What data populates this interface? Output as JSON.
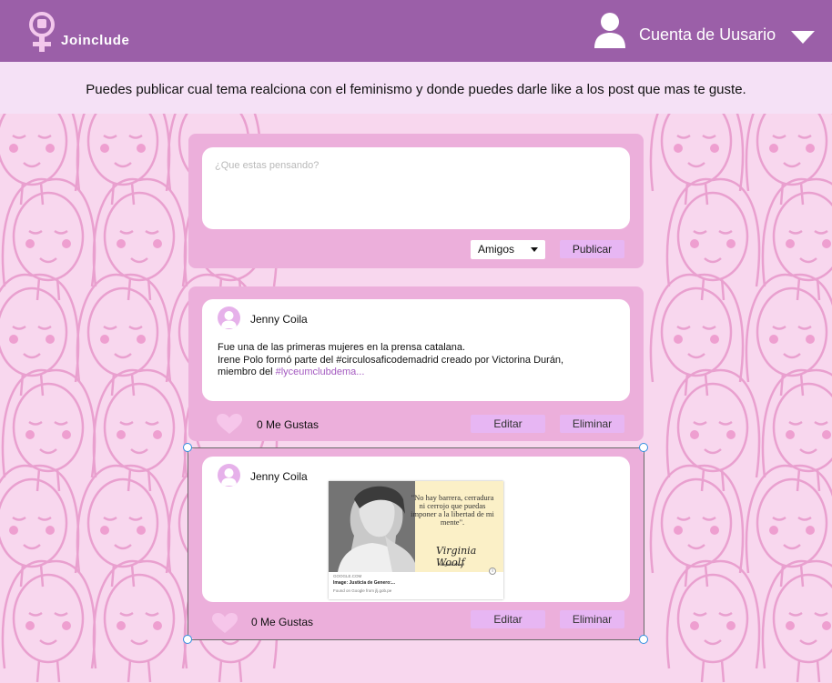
{
  "app": {
    "brand": "Joinclude",
    "account_label": "Cuenta de Uusario"
  },
  "info": {
    "text": "Puedes publicar cual tema  realciona con el feminismo y donde puedes darle like a los post que mas te guste."
  },
  "composer": {
    "placeholder": "¿Que estas pensando?",
    "audience_selected": "Amigos",
    "publish_label": "Publicar"
  },
  "posts": [
    {
      "author": "Jenny Coila",
      "text_line1": "Fue una de las primeras mujeres en la prensa catalana.",
      "text_line2": "Irene Polo formó parte del #circulosaficodemadrid creado por Victorina Durán,",
      "text_line3_prefix": "miembro del ",
      "hashtag": "#lyceumclubdema...",
      "likes_label": "0 Me Gustas",
      "edit_label": "Editar",
      "delete_label": "Eliminar"
    },
    {
      "author": "Jenny Coila",
      "likes_label": "0 Me Gustas",
      "edit_label": "Editar",
      "delete_label": "Eliminar",
      "preview": {
        "quote": "\"No hay barrera, cerradura ni cerrojo que puedas imponer a la libertad de mi mente\".",
        "signature": "Virginia Woolf",
        "signature_name": "Virginia Woolf",
        "source": "GOOGLE.COM",
        "title": "Image: Justicia de Genero:...",
        "found": "Found on Google from jlj.gob.pe"
      }
    }
  ],
  "colors": {
    "header": "#9b5fa8",
    "info_bar": "#f5e1f6",
    "card": "#ecafdb",
    "button": "#e7b6f3",
    "background": "#f8d7ee",
    "pattern_line": "#e9a0cf"
  },
  "icons": {
    "logo": "female-symbol-fist-icon",
    "user": "user-icon",
    "dropdown": "chevron-down-icon",
    "like": "heart-icon",
    "avatar": "avatar-icon"
  }
}
